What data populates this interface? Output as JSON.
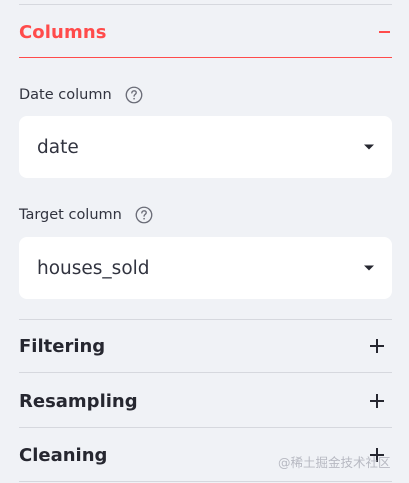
{
  "columns_section": {
    "title": "Columns",
    "toggle_icon": "minus-icon",
    "accent_color": "#ff4b4b"
  },
  "date_column": {
    "label": "Date column",
    "help_icon": "question-circle-icon",
    "value": "date",
    "caret_icon": "caret-down-icon"
  },
  "target_column": {
    "label": "Target column",
    "help_icon": "question-circle-icon",
    "value": "houses_sold",
    "caret_icon": "caret-down-icon"
  },
  "collapsed_sections": [
    {
      "title": "Filtering",
      "toggle_icon": "plus-icon"
    },
    {
      "title": "Resampling",
      "toggle_icon": "plus-icon"
    },
    {
      "title": "Cleaning",
      "toggle_icon": "plus-icon"
    }
  ],
  "watermark": "@稀土掘金技术社区"
}
